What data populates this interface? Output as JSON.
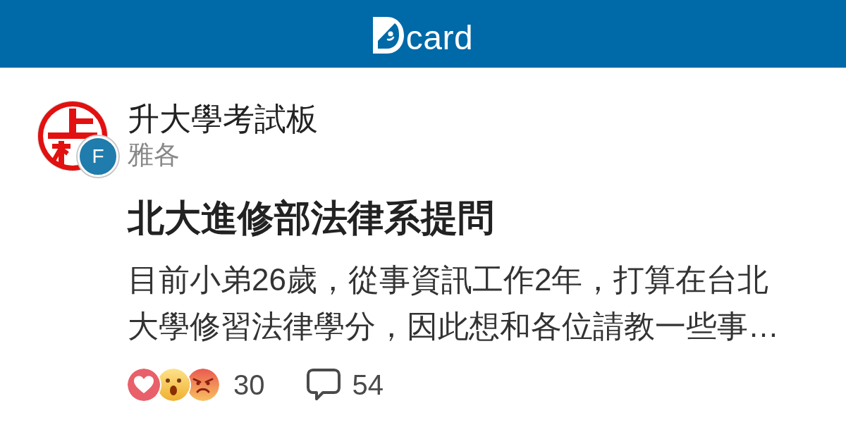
{
  "header": {
    "logo_text": "card"
  },
  "post": {
    "board": {
      "name": "升大學考試板"
    },
    "author": {
      "name": "雅各",
      "avatar_letter": "F"
    },
    "title": "北大進修部法律系提問",
    "excerpt": "目前小弟26歲，從事資訊工作2年，打算在台北大學修習法律學分，因此想和各位請教一些事…",
    "reactions": [
      {
        "kind": "heart"
      },
      {
        "kind": "surprised"
      },
      {
        "kind": "angry"
      }
    ],
    "reaction_count": "30",
    "comment_count": "54"
  }
}
